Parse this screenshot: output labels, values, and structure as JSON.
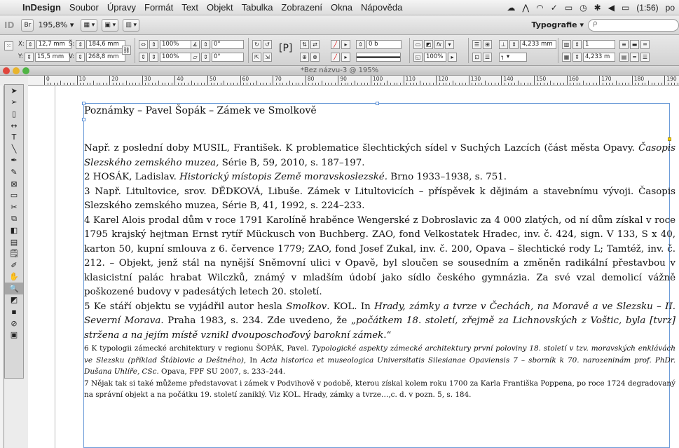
{
  "menubar": {
    "app": "InDesign",
    "menus": [
      "Soubor",
      "Úpravy",
      "Formát",
      "Text",
      "Objekt",
      "Tabulka",
      "Zobrazení",
      "Okna",
      "Nápověda"
    ],
    "battery": "(1:56)",
    "clock": "po"
  },
  "appbar": {
    "app_logo": "ID",
    "bridge_label": "Br",
    "zoom": "195,8% ▾",
    "workspace": "Typografie ▾",
    "search_placeholder": "ρ"
  },
  "control": {
    "x": "12,7 mm",
    "y": "15,5 mm",
    "w": "184,6 mm",
    "h": "268,8 mm",
    "scale_x": "100%",
    "scale_y": "100%",
    "angle": "0°",
    "shear": "0°",
    "stroke": "0 b",
    "opacity": "100%",
    "gutter": "4,233 mm",
    "columns": "1",
    "col_width": "4,233 m",
    "x_label": "X:",
    "y_label": "Y:",
    "w_label": "Š:",
    "h_label": "V:"
  },
  "document": {
    "title": "*Bez názvu-3 @ 195%"
  },
  "ruler": {
    "labels": [
      "0",
      "10",
      "20",
      "30",
      "40",
      "50",
      "60",
      "70",
      "80",
      "90",
      "100",
      "110",
      "120",
      "130",
      "140",
      "150",
      "160",
      "170",
      "180",
      "190"
    ]
  },
  "tools": [
    {
      "name": "selection-tool",
      "glyph": "➤"
    },
    {
      "name": "direct-selection-tool",
      "glyph": "➢"
    },
    {
      "name": "page-tool",
      "glyph": "▯"
    },
    {
      "name": "gap-tool",
      "glyph": "↔"
    },
    {
      "name": "type-tool",
      "glyph": "T"
    },
    {
      "name": "line-tool",
      "glyph": "╲"
    },
    {
      "name": "pen-tool",
      "glyph": "✒"
    },
    {
      "name": "pencil-tool",
      "glyph": "✎"
    },
    {
      "name": "rectangle-frame-tool",
      "glyph": "⊠"
    },
    {
      "name": "rectangle-tool",
      "glyph": "▭"
    },
    {
      "name": "scissors-tool",
      "glyph": "✂"
    },
    {
      "name": "free-transform-tool",
      "glyph": "⧉"
    },
    {
      "name": "gradient-swatch-tool",
      "glyph": "◧"
    },
    {
      "name": "gradient-feather-tool",
      "glyph": "▤"
    },
    {
      "name": "note-tool",
      "glyph": "🗒"
    },
    {
      "name": "eyedropper-tool",
      "glyph": "✐"
    },
    {
      "name": "hand-tool",
      "glyph": "✋"
    },
    {
      "name": "zoom-tool",
      "glyph": "🔍"
    },
    {
      "name": "fill-stroke-swatch",
      "glyph": "◩"
    },
    {
      "name": "apply-color",
      "glyph": "▪"
    },
    {
      "name": "apply-none",
      "glyph": "⊘"
    },
    {
      "name": "screen-mode",
      "glyph": "▣"
    }
  ],
  "content": {
    "heading": "Poznámky – Pavel Šopák – Zámek ve Smolkově",
    "n1a": " Např. z poslední doby MUSIL, František. K problematice šlechtických sídel v Suchých Lazcích (část města Opavy. ",
    "n1b": "Časopis Slezského zemského muzea,",
    "n1c": " Série B, 59, 2010, s. 187–197.",
    "n2a": "2 HOSÁK, Ladislav. ",
    "n2b": "Historický místopis Země moravskoslezské.",
    "n2c": " Brno 1933–1938, s. 751.",
    "n3": "3 Např. Litultovice, srov. DĚDKOVÁ, Libuše. Zámek v Litultovicích – příspěvek k dějinám a stavebnímu vývoji. Časopis Slezského zemského muzea, Série B, 41, 1992, s. 224–233.",
    "n4": "4 Karel Alois prodal dům v roce 1791 Karolíně hraběnce Wengerské z Dobroslavic za 4 000 zlatých, od ní dům získal v roce 1795 krajský hejtman Ernst rytíř Mückusch von Buchberg. ZAO, fond Velkostatek Hradec, inv. č. 424, sign. V 133, S x 40, karton 50, kupní smlouva z 6. července 1779; ZAO, fond Josef Zukal, inv. č. 200, Opava – šlechtické rody L; Tamtéž, inv. č. 212. – Objekt, jenž stál na nynější Sněmovní ulici v Opavě, byl sloučen se sousedním a změněn radikální přestavbou v klasicistní palác hrabat Wilczků, známý v mladším údobí jako sídlo českého gymnázia. Za své vzal demolicí vážně poškozené budovy v padesátých letech 20. století.",
    "n5a": "5 Ke stáří objektu se vyjádřil autor hesla ",
    "n5b": "Smolkov",
    "n5c": ". KOL. In ",
    "n5d": "Hrady, zámky a tvrze v Čechách, na Moravě a ve Slezsku – II. Severní Morava",
    "n5e": ". Praha 1983, s. 234. Zde uvedeno, že „",
    "n5f": "počátkem 18. století, zřejmě za Lichnovských z Voštic, byla [tvrz] stržena a na jejím místě vznikl dvouposchoďový barokní zámek",
    "n5g": ".“",
    "n6a": "6 K typologii zámecké architektury v regionu ŠOPÁK, Pavel. ",
    "n6b": "Typologické aspekty zámecké architektury první poloviny 18. století v tzv. moravských enklávách ve Slezsku (příklad Štáblovic a Deštného)",
    "n6c": ", In ",
    "n6d": "Acta historica et museologica Universitatis Silesianae Opaviensis 7 – sborník k 70. narozeninám prof. PhDr. Dušana Uhlíře, CSc.",
    "n6e": " Opava, FPF SU 2007, s. 233–244.",
    "n7": "7 Nějak tak si také můžeme představovat i zámek v Podvihově v podobě, kterou získal kolem roku 1700 za Karla Františka Poppena, po roce 1724 degradovaný na správní objekt a na počátku 19. století zaniklý. Viz KOL. Hrady, zámky a tvrze…,c. d. v pozn. 5, s. 184."
  }
}
